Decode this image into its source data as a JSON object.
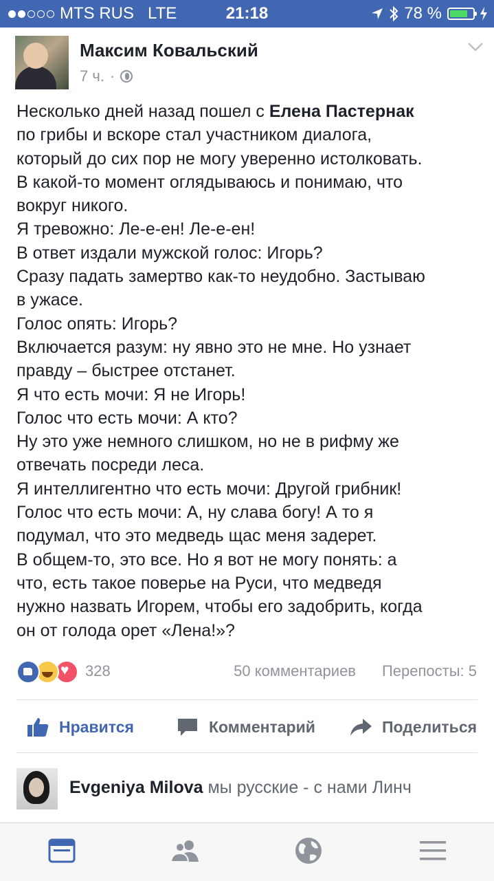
{
  "status_bar": {
    "carrier": "MTS RUS",
    "network": "LTE",
    "time": "21:18",
    "battery_percent": "78 %",
    "battery_level": 0.78,
    "signal_bars_filled": 2,
    "signal_bars_total": 5
  },
  "post": {
    "author": "Максим Ковальский",
    "time": "7 ч.",
    "separator": "·",
    "privacy_icon": "globe-icon",
    "text_lines": [
      {
        "pre": "Несколько дней назад пошел с ",
        "bold": "Елена Пастернак",
        "post": ""
      },
      {
        "pre": "по грибы и вскоре стал участником диалога,",
        "bold": "",
        "post": ""
      },
      {
        "pre": "который до сих пор не могу уверенно истолковать.",
        "bold": "",
        "post": ""
      },
      {
        "pre": "В какой-то момент оглядываюсь и понимаю, что",
        "bold": "",
        "post": ""
      },
      {
        "pre": "вокруг никого.",
        "bold": "",
        "post": ""
      },
      {
        "pre": "Я тревожно: Ле-е-ен! Ле-е-ен!",
        "bold": "",
        "post": ""
      },
      {
        "pre": "В ответ издали мужской голос: Игорь?",
        "bold": "",
        "post": ""
      },
      {
        "pre": "Сразу падать замертво как-то неудобно. Застываю",
        "bold": "",
        "post": ""
      },
      {
        "pre": "в ужасе.",
        "bold": "",
        "post": ""
      },
      {
        "pre": "Голос опять: Игорь?",
        "bold": "",
        "post": ""
      },
      {
        "pre": "Включается разум: ну явно это не мне. Но узнает",
        "bold": "",
        "post": ""
      },
      {
        "pre": "правду – быстрее отстанет.",
        "bold": "",
        "post": ""
      },
      {
        "pre": "Я что есть мочи: Я не Игорь!",
        "bold": "",
        "post": ""
      },
      {
        "pre": "Голос что есть мочи: А кто?",
        "bold": "",
        "post": ""
      },
      {
        "pre": "Ну это уже немного слишком, но не в рифму же",
        "bold": "",
        "post": ""
      },
      {
        "pre": "отвечать посреди леса.",
        "bold": "",
        "post": ""
      },
      {
        "pre": "Я интеллигентно что есть мочи: Другой грибник!",
        "bold": "",
        "post": ""
      },
      {
        "pre": "Голос что есть мочи: А, ну слава богу! А то я",
        "bold": "",
        "post": ""
      },
      {
        "pre": "подумал, что это медведь щас меня задерет.",
        "bold": "",
        "post": ""
      },
      {
        "pre": "В общем-то, это все. Но я вот не могу понять: а",
        "bold": "",
        "post": ""
      },
      {
        "pre": "что, есть такое поверье на Руси, что медведя",
        "bold": "",
        "post": ""
      },
      {
        "pre": "нужно назвать Игорем, чтобы его задобрить, когда",
        "bold": "",
        "post": ""
      },
      {
        "pre": "он от голода орет «Лена!»?",
        "bold": "",
        "post": ""
      }
    ],
    "reactions": {
      "icons": [
        "like-reaction",
        "haha-reaction",
        "love-reaction"
      ],
      "count": "328"
    },
    "comments_count": "50 комментариев",
    "shares_count": "Перепосты: 5"
  },
  "actions": {
    "like": "Нравится",
    "comment": "Комментарий",
    "share": "Поделиться"
  },
  "colors": {
    "brand": "#4267b2",
    "text": "#1d2129",
    "muted": "#90949c"
  },
  "comment": {
    "author": "Evgeniya Milova",
    "text": "мы русские - с нами Линч"
  },
  "tab_bar": {
    "tabs": [
      "news-feed-icon",
      "friends-icon",
      "globe-icon",
      "menu-icon"
    ],
    "active": "news-feed-icon"
  }
}
